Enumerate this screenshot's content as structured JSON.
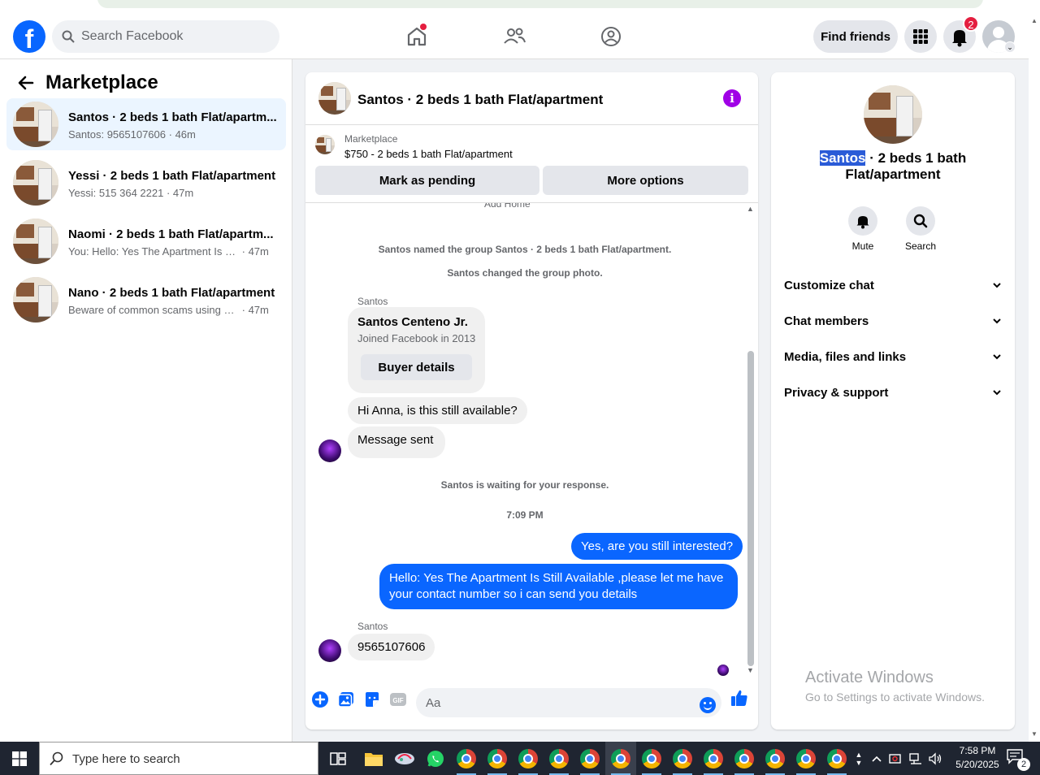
{
  "topnav": {
    "search_placeholder": "Search Facebook",
    "find_friends_label": "Find friends",
    "notification_count": "2"
  },
  "left_panel": {
    "title": "Marketplace",
    "conversations": [
      {
        "title": "Santos · 2 beds 1 bath Flat/apartm...",
        "snippet": "Santos: 9565107606",
        "time": "· 46m",
        "active": true
      },
      {
        "title": "Yessi · 2 beds 1 bath Flat/apartment",
        "snippet": "Yessi: 515 364 2221",
        "time": "· 47m",
        "active": false
      },
      {
        "title": "Naomi · 2 beds 1 bath Flat/apartm...",
        "snippet": "You: Hello: Yes The Apartment Is Still...",
        "time": "· 47m",
        "active": false
      },
      {
        "title": "Nano · 2 beds 1 bath Flat/apartment",
        "snippet": "Beware of common scams using pa...",
        "time": "· 47m",
        "active": false
      }
    ]
  },
  "chat": {
    "title": "Santos · 2 beds 1 bath Flat/apartment",
    "listing_source": "Marketplace",
    "listing_price": "$750 - 2 beds 1 bath Flat/apartment",
    "mark_pending_label": "Mark as pending",
    "more_options_label": "More options",
    "clipped_text": "Add          Home",
    "system_1": "Santos named the group Santos · 2 beds 1 bath Flat/apartment.",
    "system_2": "Santos changed the group photo.",
    "sender_1": "Santos",
    "card_name": "Santos Centeno Jr.",
    "card_joined": "Joined Facebook in 2013",
    "buyer_details_label": "Buyer details",
    "msg_in_1": "Hi Anna, is this still available?",
    "msg_in_2": "Message sent",
    "system_3": "Santos is waiting for your response.",
    "timestamp": "7:09 PM",
    "msg_out_1": "Yes, are you still interested?",
    "msg_out_2": "Hello: Yes The Apartment Is Still Available ,please let me have your contact number so i can send you details",
    "sender_2": "Santos",
    "msg_in_3": "9565107606",
    "composer_placeholder": "Aa"
  },
  "right_panel": {
    "title_highlight": "Santos",
    "title_rest": " · 2 beds 1 bath Flat/apartment",
    "mute_label": "Mute",
    "search_label": "Search",
    "sections": [
      "Customize chat",
      "Chat members",
      "Media, files and links",
      "Privacy & support"
    ],
    "activate_line1": "Activate Windows",
    "activate_line2": "Go to Settings to activate Windows."
  },
  "taskbar": {
    "search_placeholder": "Type here to search",
    "time": "7:58 PM",
    "date": "5/20/2025",
    "notification_count": "2"
  },
  "colors": {
    "brand_blue": "#0866ff",
    "outgoing_bubble": "#0a66ff",
    "info_purple": "#a000e6",
    "notification_red": "#e41e3f"
  }
}
